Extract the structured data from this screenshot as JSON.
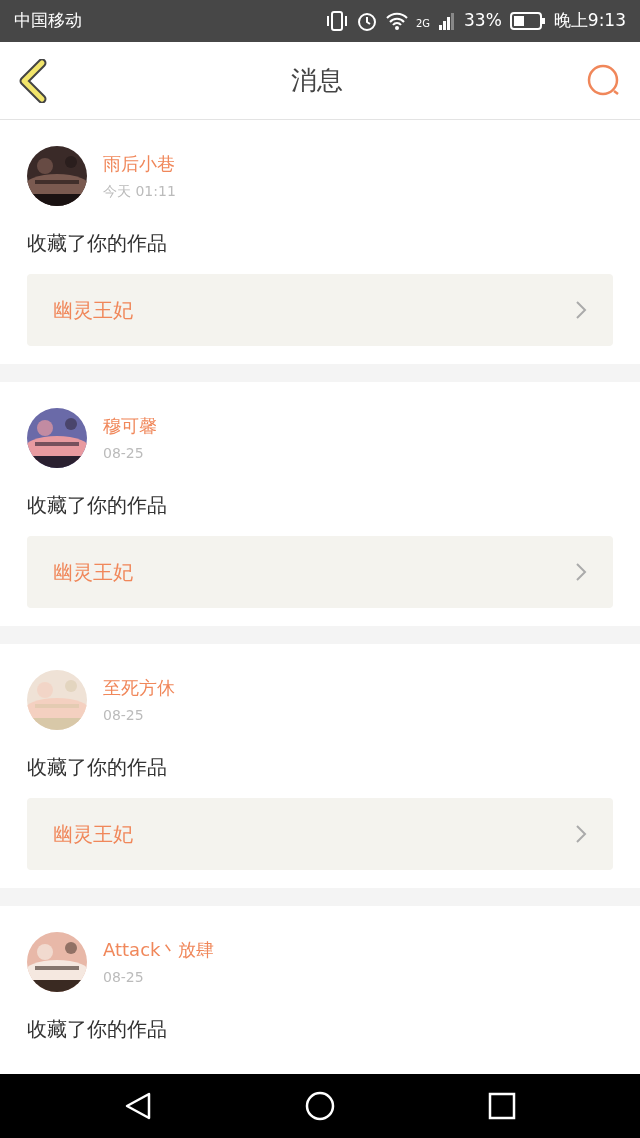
{
  "status_bar": {
    "carrier": "中国移动",
    "network": "2G",
    "battery": "33%",
    "time": "晚上9:13"
  },
  "header": {
    "title": "消息"
  },
  "messages": [
    {
      "user": "雨后小巷",
      "time": "今天 01:11",
      "action": "收藏了你的作品",
      "work": "幽灵王妃"
    },
    {
      "user": "穆可馨",
      "time": "08-25",
      "action": "收藏了你的作品",
      "work": "幽灵王妃"
    },
    {
      "user": "至死方休",
      "time": "08-25",
      "action": "收藏了你的作品",
      "work": "幽灵王妃"
    },
    {
      "user": "Attack丶放肆",
      "time": "08-25",
      "action": "收藏了你的作品"
    }
  ]
}
